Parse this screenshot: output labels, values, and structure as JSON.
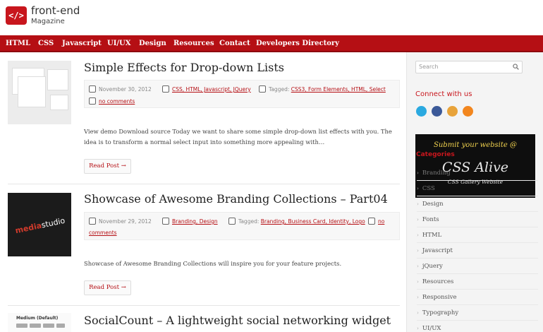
{
  "header": {
    "logo_mark": "</>",
    "title": "front-end",
    "subtitle": "Magazine"
  },
  "nav": [
    "HTML",
    "CSS",
    "Javascript",
    "UI/UX",
    "Design",
    "Resources",
    "Contact",
    "Developers Directory"
  ],
  "posts": [
    {
      "title": "Simple Effects for Drop-down Lists",
      "date": "November 30, 2012",
      "categories": "CSS, HTML, Javascript, JQuery",
      "tagged_label": "Tagged:",
      "tags": "CSS3, Form Elements, HTML, Select",
      "comments": "no comments",
      "excerpt": "View demo Download source Today we want to share some simple drop-down list effects with you. The idea is to transform a normal select input into something more appealing with…",
      "read_more": "Read Post →"
    },
    {
      "title": "Showcase of Awesome Branding Collections – Part04",
      "date": "November 29, 2012",
      "categories": "Branding, Design",
      "tagged_label": "Tagged:",
      "tags": "Branding, Business Card, Identity, Logo",
      "comments_a": "no",
      "comments_b": "comments",
      "excerpt": "Showcase of Awesome Branding Collections will inspire you for your feature projects.",
      "read_more": "Read Post →",
      "thumb_text_a": "media",
      "thumb_text_b": "studio"
    },
    {
      "title": "SocialCount – A lightweight social networking widget",
      "thumb_label": "Medium (Default)"
    }
  ],
  "sidebar": {
    "search_placeholder": "Search",
    "connect_title": "Connect with us",
    "social_icons": [
      "twitter-icon",
      "facebook-icon",
      "google-icon",
      "rss-icon"
    ],
    "promo": {
      "line1": "Submit your website @",
      "line2": "CSS Alive",
      "line3": "CSS Gallery Website"
    },
    "categories_title": "Categories",
    "categories": [
      "Branding",
      "CSS",
      "Design",
      "Fonts",
      "HTML",
      "Javascript",
      "jQuery",
      "Resources",
      "Responsive",
      "Typography",
      "UI/UX"
    ]
  },
  "colors": {
    "brand_red": "#b50f14",
    "accent_red": "#c8161d",
    "twitter": "#2aa9e0",
    "facebook": "#3b5998",
    "google": "#e8a33a",
    "rss": "#f2861e"
  }
}
